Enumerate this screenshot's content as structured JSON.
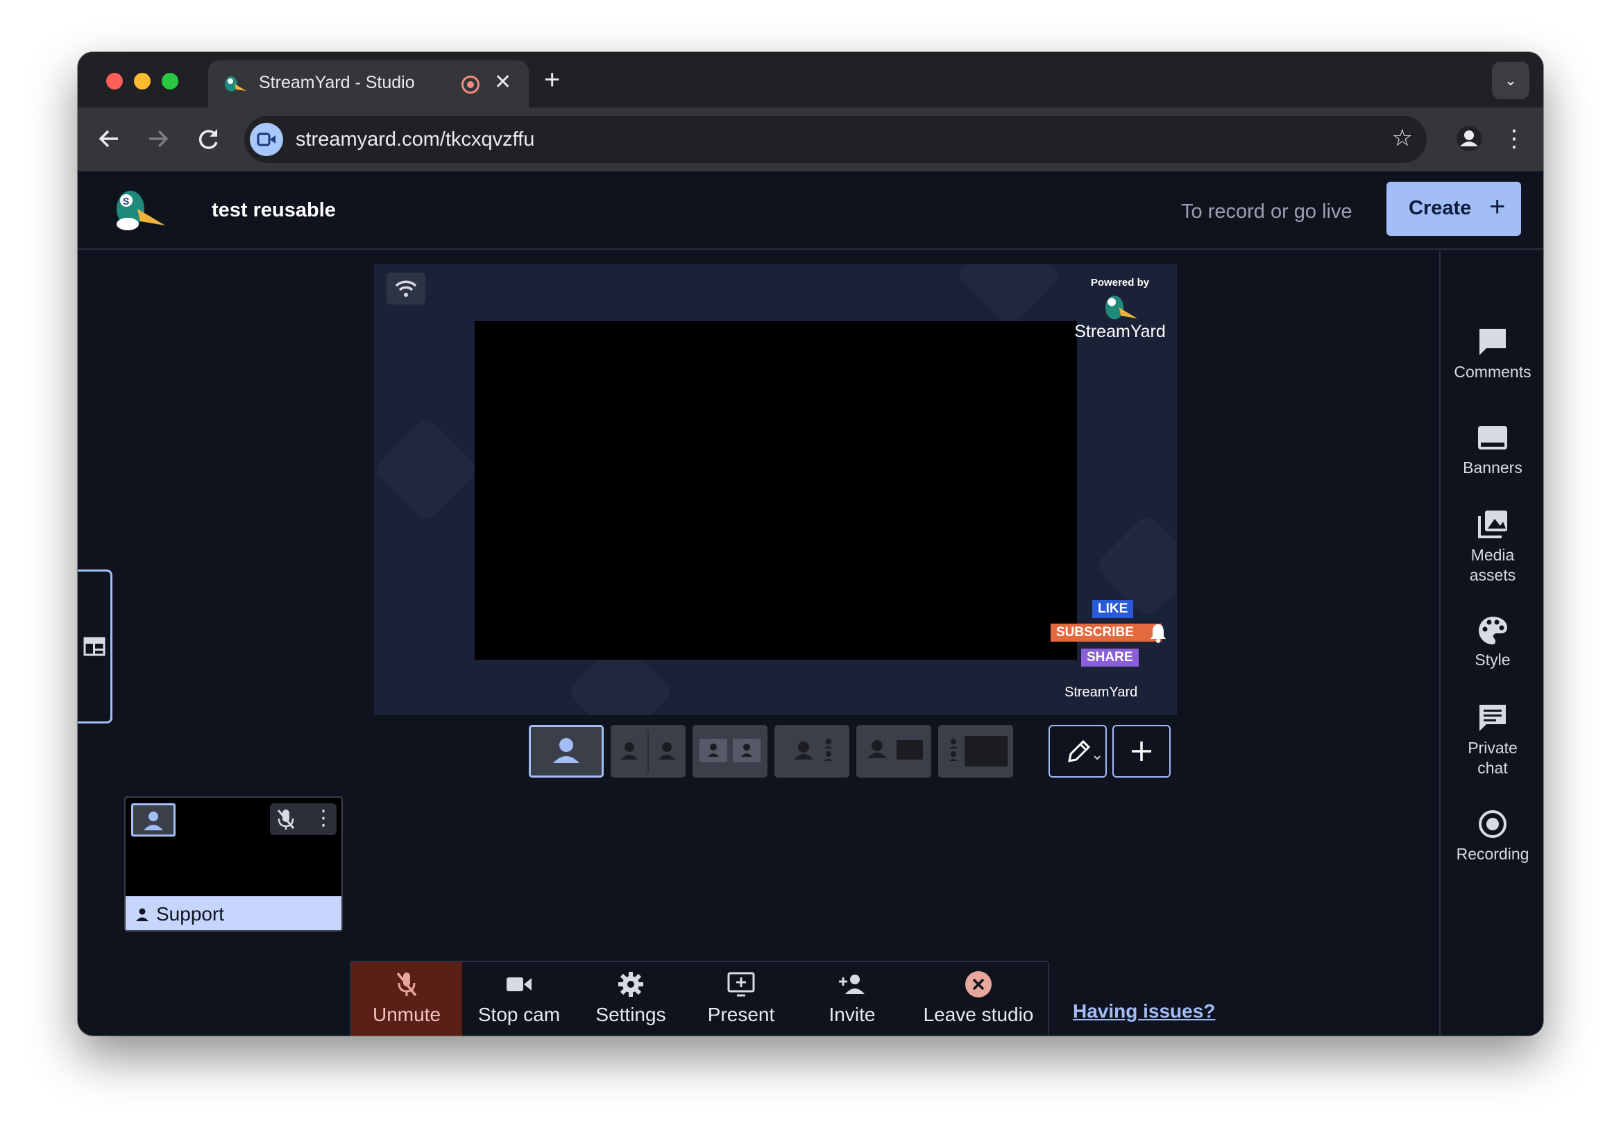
{
  "browser": {
    "tab_title": "StreamYard - Studio",
    "tab_close": "✕",
    "new_tab": "+",
    "url": "streamyard.com/tkcxqvzffu"
  },
  "header": {
    "studio_name": "test reusable",
    "hint": "To record or go live",
    "create_label": "Create",
    "create_plus": "+"
  },
  "sidebar": {
    "items": [
      {
        "label": "Comments",
        "icon": "comments-icon"
      },
      {
        "label": "Banners",
        "icon": "banners-icon"
      },
      {
        "label": "Media\nassets",
        "icon": "media-assets-icon"
      },
      {
        "label": "Style",
        "icon": "style-icon"
      },
      {
        "label": "Private\nchat",
        "icon": "private-chat-icon"
      },
      {
        "label": "Recording",
        "icon": "recording-icon"
      }
    ]
  },
  "stage": {
    "powered_by": "Powered by",
    "brand": "StreamYard",
    "badges": {
      "like": "LIKE",
      "subscribe": "SUBSCRIBE",
      "share": "SHARE"
    },
    "footer_brand": "StreamYard"
  },
  "participant": {
    "name": "Support"
  },
  "controls": {
    "unmute": "Unmute",
    "stop_cam": "Stop cam",
    "settings": "Settings",
    "present": "Present",
    "invite": "Invite",
    "leave": "Leave studio",
    "issues": "Having issues?"
  },
  "colors": {
    "accent": "#a3bdf7",
    "background": "#0f131e",
    "stage": "#1b2137",
    "danger": "#e8a79c"
  }
}
